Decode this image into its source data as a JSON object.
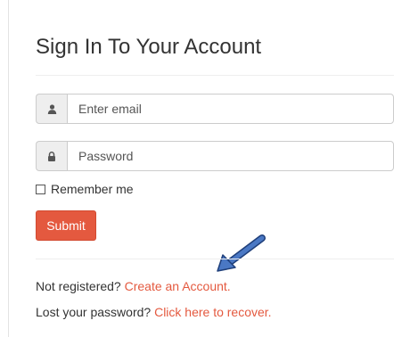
{
  "title": "Sign In To Your Account",
  "email": {
    "icon": "user-icon",
    "placeholder": "Enter email"
  },
  "password": {
    "icon": "lock-icon",
    "placeholder": "Password"
  },
  "remember": {
    "label": "Remember me",
    "checked": false
  },
  "submit_label": "Submit",
  "register": {
    "prompt": "Not registered?",
    "link": "Create an Account."
  },
  "recover": {
    "prompt": "Lost your password?",
    "link": "Click here to recover."
  },
  "colors": {
    "accent": "#e4593f",
    "arrow": "#4a78c4"
  }
}
